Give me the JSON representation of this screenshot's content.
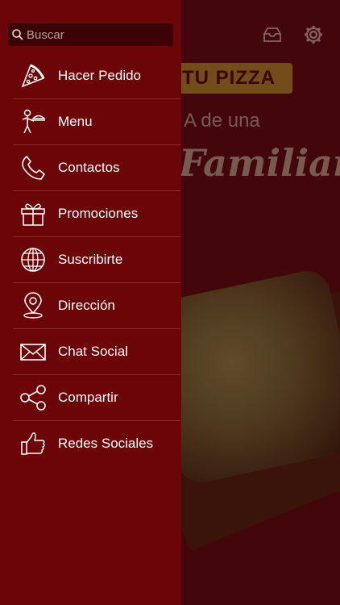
{
  "search": {
    "placeholder": "Buscar"
  },
  "background": {
    "banner_text": "TU PIZZA",
    "line1": "A de una",
    "line2": "Familiar"
  },
  "menu": {
    "items": [
      {
        "label": "Hacer Pedido",
        "icon": "pizza-slice-icon"
      },
      {
        "label": "Menu",
        "icon": "waiter-icon"
      },
      {
        "label": "Contactos",
        "icon": "phone-icon"
      },
      {
        "label": "Promociones",
        "icon": "gift-icon"
      },
      {
        "label": "Suscribirte",
        "icon": "globe-icon"
      },
      {
        "label": "Dirección",
        "icon": "location-pin-icon"
      },
      {
        "label": "Chat Social",
        "icon": "envelope-icon"
      },
      {
        "label": "Compartir",
        "icon": "share-icon"
      },
      {
        "label": "Redes Sociales",
        "icon": "thumbs-up-icon"
      }
    ]
  },
  "colors": {
    "drawer": "#6b0508",
    "accent": "#b08a2a"
  }
}
